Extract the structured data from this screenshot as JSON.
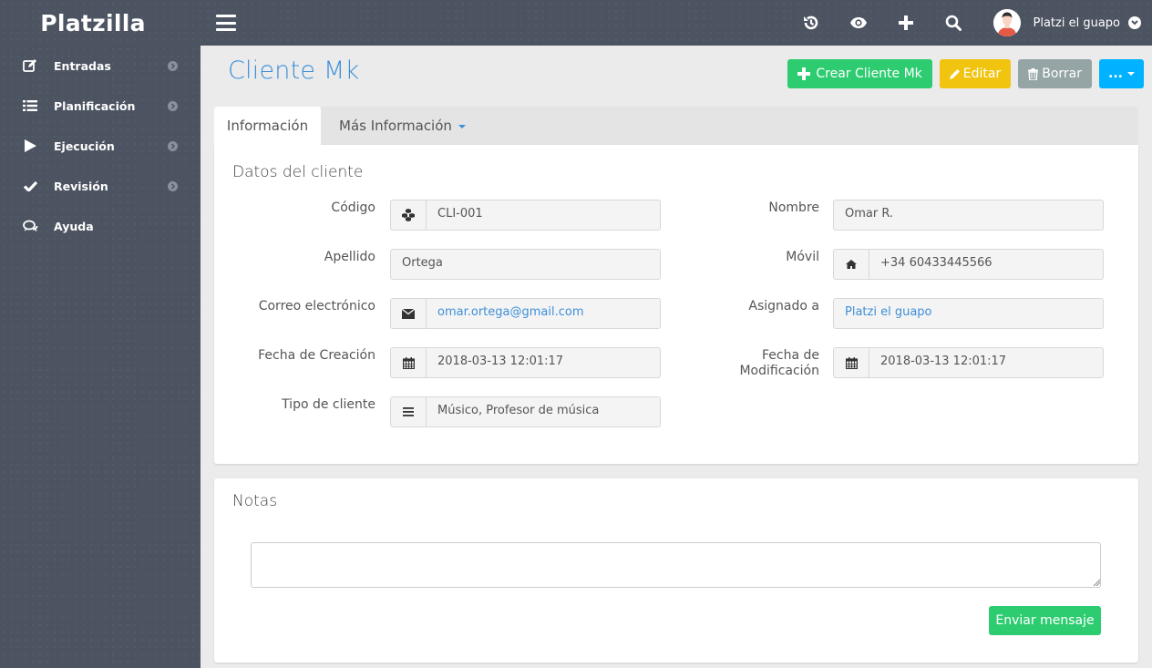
{
  "app": {
    "brand": "Platzilla",
    "user_name": "Platzi el guapo"
  },
  "topbar": {
    "icons": [
      "history-icon",
      "eye-icon",
      "plus-icon",
      "search-icon"
    ]
  },
  "sidebar": {
    "items": [
      {
        "label": "Entradas",
        "icon": "edit-icon",
        "has_arrow": true
      },
      {
        "label": "Planificación",
        "icon": "list-icon",
        "has_arrow": true
      },
      {
        "label": "Ejecución",
        "icon": "play-icon",
        "has_arrow": true
      },
      {
        "label": "Revisión",
        "icon": "check-icon",
        "has_arrow": true
      },
      {
        "label": "Ayuda",
        "icon": "comments-icon",
        "has_arrow": false
      }
    ]
  },
  "page": {
    "title": "Cliente Mk",
    "actions": {
      "create_label": "Crear Cliente Mk",
      "edit_label": "Editar",
      "delete_label": "Borrar",
      "more_label": "..."
    },
    "tabs": [
      {
        "label": "Información",
        "active": true
      },
      {
        "label": "Más Información",
        "active": false,
        "dropdown": true
      }
    ]
  },
  "client_data": {
    "section_title": "Datos del cliente",
    "fields": {
      "codigo": {
        "label": "Código",
        "value": "CLI-001",
        "icon": "cubes-icon"
      },
      "nombre": {
        "label": "Nombre",
        "value": "Omar R."
      },
      "apellido": {
        "label": "Apellido",
        "value": "Ortega"
      },
      "movil": {
        "label": "Móvil",
        "value": "+34 60433445566",
        "icon": "home-icon"
      },
      "correo": {
        "label": "Correo electrónico",
        "value": "omar.ortega@gmail.com",
        "icon": "envelope-icon"
      },
      "asignado": {
        "label": "Asignado a",
        "value": "Platzi el guapo"
      },
      "fecha_creacion": {
        "label": "Fecha de Creación",
        "value": "2018-03-13 12:01:17",
        "icon": "calendar-icon"
      },
      "fecha_modificacion": {
        "label_line1": "Fecha de",
        "label_line2": "Modificación",
        "value": "2018-03-13 12:01:17",
        "icon": "calendar-icon"
      },
      "tipo": {
        "label": "Tipo de cliente",
        "value": "Músico, Profesor de música",
        "icon": "bars-icon"
      }
    }
  },
  "notes": {
    "section_title": "Notas",
    "textarea_value": "",
    "send_label": "Enviar mensaje"
  },
  "colors": {
    "sidebar_bg": "#4c5361",
    "accent_blue": "#3e8fd8",
    "success_green": "#2ecc71",
    "warning_yellow": "#f1c40f",
    "neutral_gray": "#95a5a6",
    "info_blue": "#00b2ff"
  }
}
